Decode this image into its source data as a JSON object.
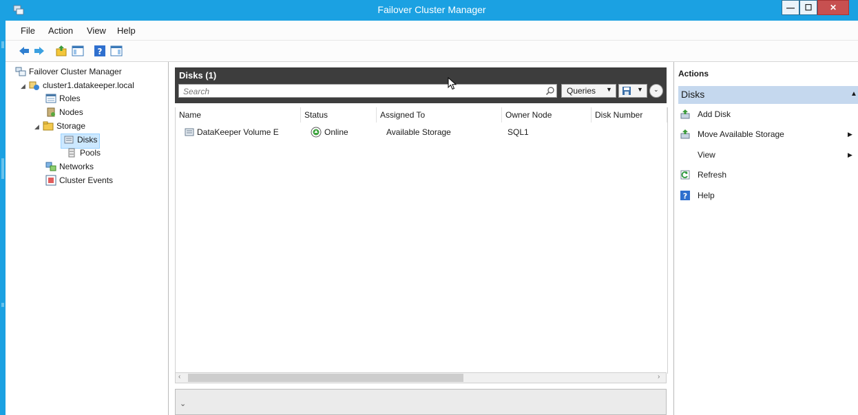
{
  "window": {
    "title": "Failover Cluster Manager"
  },
  "menu": [
    "File",
    "Action",
    "View",
    "Help"
  ],
  "tree": {
    "items": [
      {
        "label": "Failover Cluster Manager"
      },
      {
        "label": "cluster1.datakeeper.local"
      },
      {
        "label": "Roles"
      },
      {
        "label": "Nodes"
      },
      {
        "label": "Storage"
      },
      {
        "label": "Disks"
      },
      {
        "label": "Pools"
      },
      {
        "label": "Networks"
      },
      {
        "label": "Cluster Events"
      }
    ]
  },
  "center": {
    "title": "Disks (1)",
    "search_placeholder": "Search",
    "queries_label": "Queries",
    "columns": [
      "Name",
      "Status",
      "Assigned To",
      "Owner Node",
      "Disk Number"
    ],
    "rows": [
      {
        "name": "DataKeeper Volume E",
        "status": "Online",
        "assigned_to": "Available Storage",
        "owner_node": "SQL1",
        "disk_number": ""
      }
    ]
  },
  "actions": {
    "title": "Actions",
    "section": "Disks",
    "items": [
      {
        "label": "Add Disk"
      },
      {
        "label": "Move Available Storage"
      },
      {
        "label": "View"
      },
      {
        "label": "Refresh"
      },
      {
        "label": "Help"
      }
    ]
  }
}
